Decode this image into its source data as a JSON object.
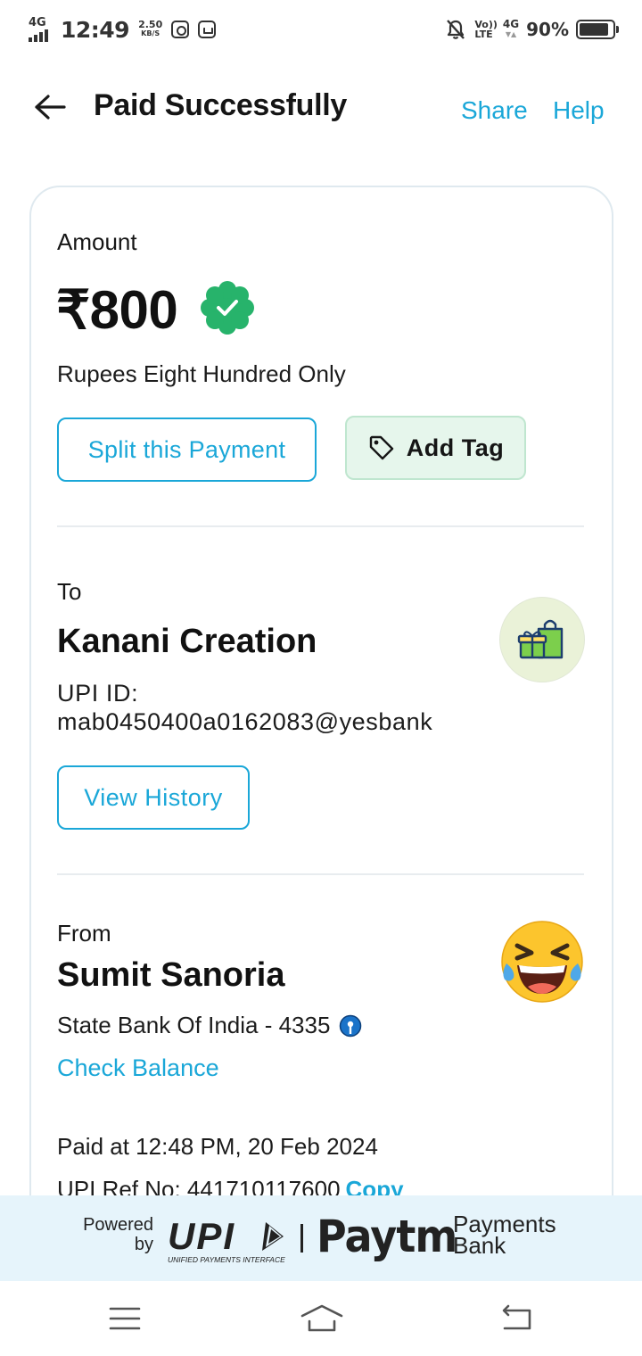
{
  "status_bar": {
    "network": "4G",
    "time": "12:49",
    "speed_value": "2.50",
    "speed_unit": "KB/S",
    "volte_top": "Vo))",
    "volte_bottom": "LTE",
    "network_right": "4G",
    "battery_percent": "90%",
    "battery_level": 0.9
  },
  "header": {
    "title": "Paid Successfully",
    "share_label": "Share",
    "help_label": "Help"
  },
  "amount": {
    "label": "Amount",
    "value": "₹800",
    "in_words": "Rupees Eight Hundred Only",
    "verified_icon_color": "#27b36b"
  },
  "actions": {
    "split_label": "Split this Payment",
    "tag_label": "Add Tag"
  },
  "to": {
    "label": "To",
    "name": "Kanani Creation",
    "upi_id_label": "UPI ID:",
    "upi_id": "mab0450400a0162083@yesbank",
    "history_label": "View History",
    "avatar_icon": "shopping-bag-gift-icon"
  },
  "from": {
    "label": "From",
    "name": "Sumit Sanoria",
    "bank": "State Bank Of India - 4335",
    "bank_icon": "sbi-logo-icon",
    "check_balance_label": "Check Balance",
    "avatar_icon": "laughing-emoji-icon"
  },
  "details": {
    "paid_at": "Paid at 12:48 PM, 20 Feb 2024",
    "ref_label": "UPI Ref No: 441710117600",
    "copy_label": "Copy"
  },
  "footer": {
    "powered_line1": "Powered",
    "powered_line2": "by",
    "upi_brand": "UPI",
    "upi_tagline": "UNIFIED PAYMENTS INTERFACE",
    "paytm_brand": "Paytm",
    "pb_line1": "Payments",
    "pb_line2": "Bank"
  },
  "colors": {
    "accent": "#1aa7d8",
    "tag_bg": "#e6f6ec",
    "footer_bg": "#e6f4fb"
  }
}
